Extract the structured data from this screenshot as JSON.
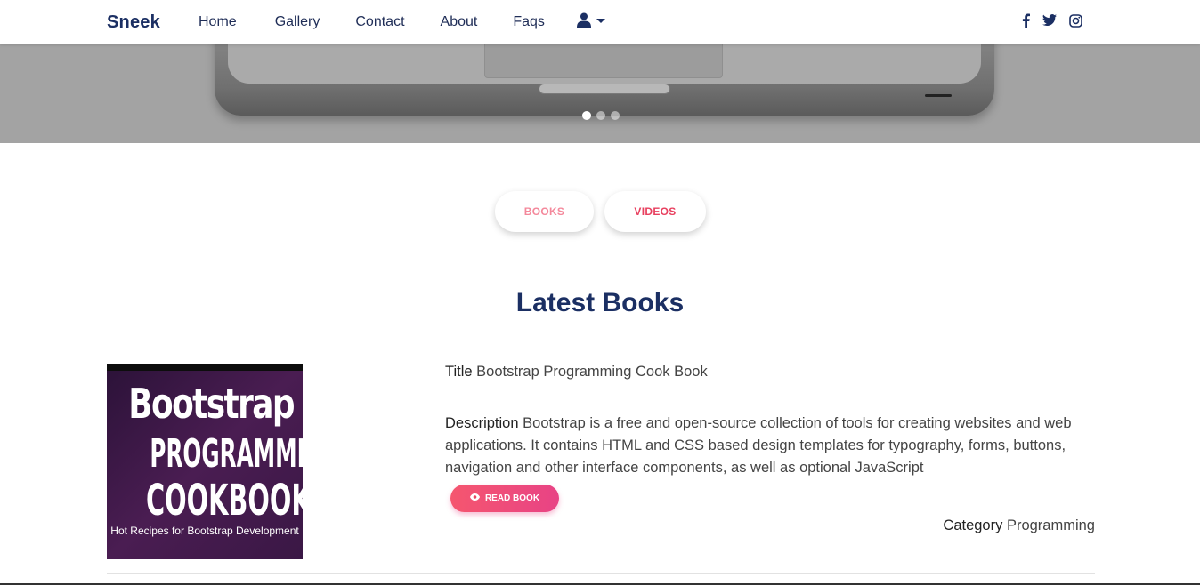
{
  "navbar": {
    "brand": "Sneek",
    "links": [
      "Home",
      "Gallery",
      "Contact",
      "About",
      "Faqs"
    ],
    "user_icon": "user-icon",
    "social_icons": [
      "facebook-icon",
      "twitter-icon",
      "instagram-icon"
    ]
  },
  "hero": {
    "slides": 3,
    "active_slide": 1
  },
  "toggle": {
    "books": "BOOKS",
    "videos": "VIDEOS"
  },
  "section": {
    "title": "Latest Books"
  },
  "book": {
    "cover": {
      "line1": "Bootstrap",
      "line2": "PROGRAMMING",
      "line3": "COOKBOOK",
      "line4": "Hot Recipes for Bootstrap Development"
    },
    "title_label": "Title",
    "title": "Bootstrap Programming Cook Book",
    "description_label": "Description",
    "description": "Bootstrap is a free and open-source collection of tools for creating websites and web applications. It contains HTML and CSS based design templates for typography, forms, buttons, navigation and other interface components, as well as optional JavaScript",
    "read_button": "READ BOOK",
    "category_label": "Category",
    "category": "Programming"
  },
  "colors": {
    "navy": "#1b2f63",
    "accent": "#e8405f",
    "hero_bg": "#a3a3a3"
  }
}
